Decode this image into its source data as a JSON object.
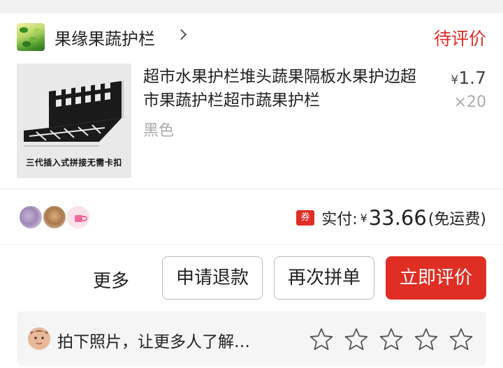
{
  "shop": {
    "name": "果缘果蔬护栏",
    "status": "待评价",
    "logo_icon": "shop-logo-icon"
  },
  "product": {
    "title": "超市水果护栏堆头蔬果隔板水果护边超市果蔬护栏超市蔬果护栏",
    "spec": "黑色",
    "currency": "¥",
    "price": "1.7",
    "quantity": "×20",
    "image_caption": "三代插入式拼接无需卡扣"
  },
  "order": {
    "coupon_badge": "券",
    "paid_label": "实付:",
    "currency": "¥",
    "paid_amount": "33.66",
    "shipping_note": "(免运费)"
  },
  "actions": {
    "more": "更多",
    "refund": "申请退款",
    "regroup": "再次拼单",
    "review": "立即评价"
  },
  "review_prompt": {
    "text": "拍下照片，让更多人了解…",
    "star_count": 5
  },
  "colors": {
    "accent": "#e02e24",
    "muted": "#aaaaaa",
    "background": "#f2f2f2"
  }
}
